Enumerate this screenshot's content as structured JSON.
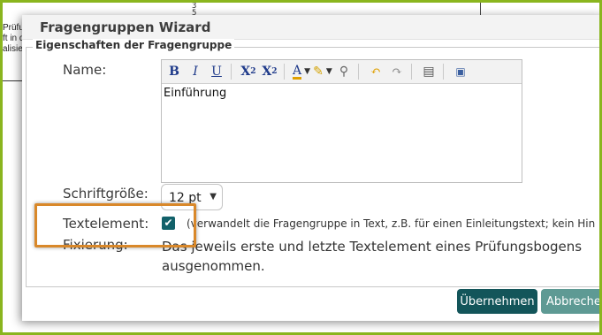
{
  "background": {
    "left_text": [
      "Prüfung",
      "ft in d",
      "alisier"
    ],
    "top_marks": [
      "3",
      "5"
    ]
  },
  "dialog": {
    "title": "Fragengruppen Wizard",
    "legend": "Eigenschaften der Fragengruppe",
    "name_label": "Name:",
    "editor_content": "Einführung",
    "toolbar_icons": [
      "bold-icon",
      "italic-icon",
      "underline-icon",
      "subscript-icon",
      "superscript-icon",
      "font-color-icon",
      "highlight-color-icon",
      "eyedropper-icon",
      "undo-icon",
      "redo-icon",
      "paste-icon",
      "source-icon"
    ],
    "font_size_label": "Schriftgröße:",
    "font_size_value": "12 pt",
    "textelement_label": "Textelement:",
    "textelement_checked": true,
    "textelement_hint": "(verwandelt die Fragengruppe in Text, z.B. für einen Einleitungstext; kein Hin",
    "fixierung_label": "Fixierung:",
    "fixierung_line1": "Das jeweils erste und letzte Textelement eines Prüfungsbogens",
    "fixierung_line2": "ausgenommen.",
    "apply_button": "Übernehmen",
    "cancel_button": "Abbrechen"
  },
  "colors": {
    "frame": "#8ab51e",
    "primary_button": "#13555a",
    "secondary_button": "#5e9a94",
    "highlight": "#d9882a",
    "checkbox": "#12616a"
  }
}
